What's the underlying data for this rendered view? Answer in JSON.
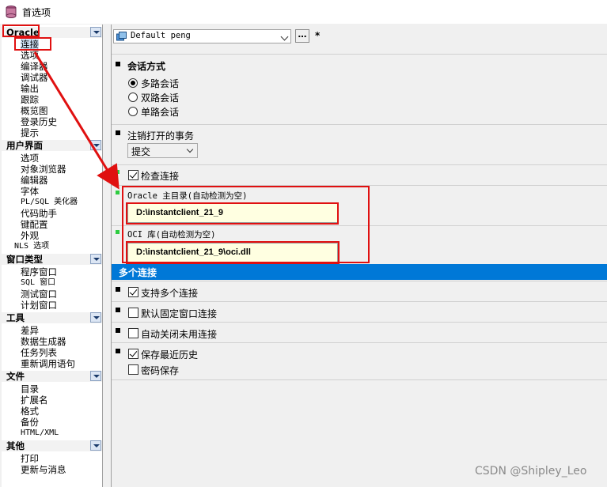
{
  "window": {
    "title": "首选项"
  },
  "sidebar": {
    "groups": [
      {
        "label": "Oracle",
        "items": [
          "连接",
          "选项",
          "编译器",
          "调试器",
          "输出",
          "跟踪",
          "概览图",
          "登录历史",
          "提示"
        ]
      },
      {
        "label": "用户界面",
        "items": [
          "选项",
          "对象浏览器",
          "编辑器",
          "字体",
          "PL/SQL 美化器",
          "代码助手",
          "键配置",
          "外观",
          "NLS 选项"
        ]
      },
      {
        "label": "窗口类型",
        "items": [
          "程序窗口",
          "SQL 窗口",
          "测试窗口",
          "计划窗口"
        ]
      },
      {
        "label": "工具",
        "items": [
          "差异",
          "数据生成器",
          "任务列表",
          "重新调用语句"
        ]
      },
      {
        "label": "文件",
        "items": [
          "目录",
          "扩展名",
          "格式",
          "备份",
          "HTML/XML"
        ]
      },
      {
        "label": "其他",
        "items": [
          "打印",
          "更新与消息"
        ]
      }
    ],
    "selected": "连接"
  },
  "toolbar": {
    "profile": "Default peng",
    "ellipsis": "…",
    "modified_marker": "*"
  },
  "session": {
    "header": "会话方式",
    "options": [
      "多路会话",
      "双路会话",
      "单路会话"
    ],
    "selected": "多路会话"
  },
  "logoff": {
    "header": "注销打开的事务",
    "value": "提交"
  },
  "check_connection": {
    "label": "检查连接",
    "checked": true
  },
  "oracle_home": {
    "label": "Oracle 主目录(自动检测为空)",
    "value": "D:\\instantclient_21_9"
  },
  "oci_library": {
    "label": "OCI 库(自动检测为空)",
    "value": "D:\\instantclient_21_9\\oci.dll"
  },
  "multi": {
    "header": "多个连接",
    "support": {
      "label": "支持多个连接",
      "checked": true
    },
    "default_fixed": {
      "label": "默认固定窗口连接",
      "checked": false
    },
    "auto_close": {
      "label": "自动关闭未用连接",
      "checked": false
    },
    "save_history": {
      "label": "保存最近历史",
      "checked": true
    },
    "save_password": {
      "label": "密码保存",
      "checked": false
    }
  },
  "watermark": "CSDN @Shipley_Leo",
  "colors": {
    "accent": "#0078d7",
    "highlight": "#e01010",
    "path_bg": "#ffffe1"
  }
}
